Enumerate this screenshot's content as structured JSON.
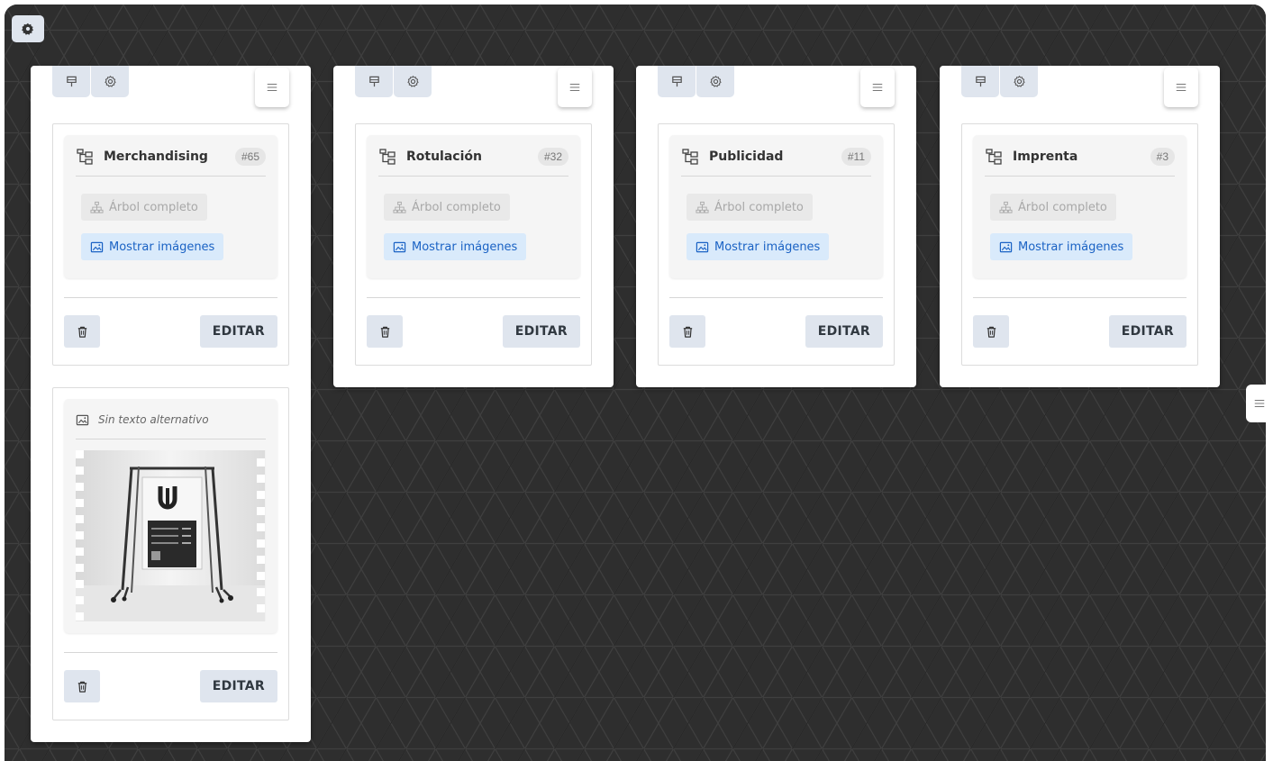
{
  "board": {
    "settings_icon": "gear-icon",
    "side_handle_icon": "hamburger-icon"
  },
  "toolbar_icons": [
    "pin-icon",
    "gear-outline-icon",
    "hamburger-icon"
  ],
  "columns": [
    {
      "category": {
        "title": "Merchandising",
        "badge": "#65",
        "tree_label": "Árbol completo",
        "images_label": "Mostrar imágenes",
        "edit_label": "EDITAR"
      },
      "image_card": {
        "alt_text": "Sin texto alternativo",
        "edit_label": "EDITAR"
      }
    },
    {
      "category": {
        "title": "Rotulación",
        "badge": "#32",
        "tree_label": "Árbol completo",
        "images_label": "Mostrar imágenes",
        "edit_label": "EDITAR"
      }
    },
    {
      "category": {
        "title": "Publicidad",
        "badge": "#11",
        "tree_label": "Árbol completo",
        "images_label": "Mostrar imágenes",
        "edit_label": "EDITAR"
      }
    },
    {
      "category": {
        "title": "Imprenta",
        "badge": "#3",
        "tree_label": "Árbol completo",
        "images_label": "Mostrar imágenes",
        "edit_label": "EDITAR"
      }
    }
  ],
  "colors": {
    "background": "#2f2f2f",
    "button_bg": "#dfe5ee",
    "link_blue": "#1a62c4",
    "chip_blue_bg": "#d9eafb"
  }
}
